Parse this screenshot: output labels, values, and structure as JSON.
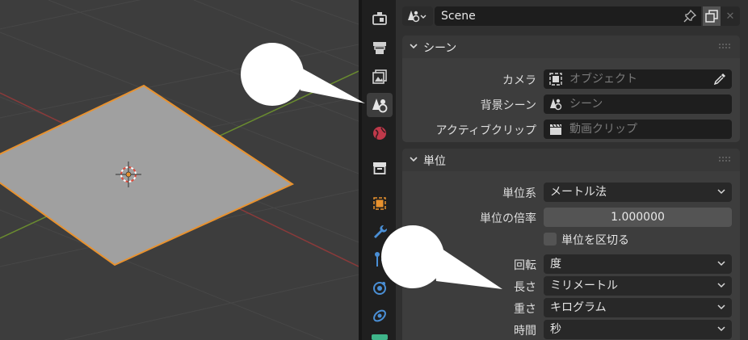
{
  "header": {
    "context_name": "Scene",
    "type_icon": "scene-icon",
    "pin_icon": "pin-icon",
    "duplicate_icon": "duplicate-icon",
    "close_icon": "close-icon",
    "close_glyph": "✕"
  },
  "tabs": [
    {
      "name": "tool-tab",
      "icon": "tool-icon"
    },
    {
      "name": "render-tab",
      "icon": "render-icon"
    },
    {
      "name": "output-tab",
      "icon": "output-icon"
    },
    {
      "name": "scene-tab",
      "icon": "scene-icon",
      "active": true
    },
    {
      "name": "world-tab",
      "icon": "world-icon"
    },
    {
      "name": "collection-tab",
      "icon": "collection-icon"
    },
    {
      "name": "object-tab",
      "icon": "object-icon"
    },
    {
      "name": "modifier-tab",
      "icon": "wrench-icon"
    },
    {
      "name": "particles-tab",
      "icon": "particles-icon"
    },
    {
      "name": "physics-tab",
      "icon": "physics-icon"
    },
    {
      "name": "constraints-tab",
      "icon": "constraints-icon"
    }
  ],
  "scene_panel": {
    "title": "シーン",
    "camera": {
      "label": "カメラ",
      "placeholder": "オブジェクト"
    },
    "background": {
      "label": "背景シーン",
      "placeholder": "シーン"
    },
    "clip": {
      "label": "アクティブクリップ",
      "placeholder": "動画クリップ"
    }
  },
  "units_panel": {
    "title": "単位",
    "unit_system": {
      "label": "単位系",
      "value": "メートル法"
    },
    "unit_scale": {
      "label": "単位の倍率",
      "value": "1.000000"
    },
    "separate_units": {
      "label": "単位を区切る",
      "checked": false
    },
    "rotation": {
      "label": "回転",
      "value": "度"
    },
    "length": {
      "label": "長さ",
      "value": "ミリメートル"
    },
    "mass": {
      "label": "重さ",
      "value": "キログラム"
    },
    "time": {
      "label": "時間",
      "value": "秒"
    }
  },
  "colors": {
    "viewport_bg": "#3d3d3d",
    "plane_fill": "#a0a0a0",
    "selection_outline": "#e8922f",
    "x_axis": "#8a3a3a",
    "y_axis": "#6a8c2f",
    "callout": "#ffffff"
  }
}
